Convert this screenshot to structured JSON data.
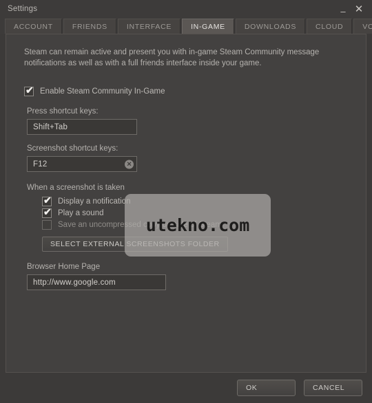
{
  "window": {
    "title": "Settings",
    "minimize_label": "–",
    "close_label": "✕"
  },
  "tabs": [
    {
      "label": "ACCOUNT",
      "active": false
    },
    {
      "label": "FRIENDS",
      "active": false
    },
    {
      "label": "INTERFACE",
      "active": false
    },
    {
      "label": "IN-GAME",
      "active": true
    },
    {
      "label": "DOWNLOADS",
      "active": false
    },
    {
      "label": "CLOUD",
      "active": false
    },
    {
      "label": "VOICE",
      "active": false
    }
  ],
  "main": {
    "description": "Steam can remain active and present you with in-game Steam Community message notifications as well as with a full friends interface inside your game.",
    "enable_community": {
      "label": "Enable Steam Community In-Game",
      "checked": true,
      "check_glyph": "✔"
    },
    "press_shortcut": {
      "label": "Press shortcut keys:",
      "value": "Shift+Tab",
      "placeholder": ""
    },
    "screenshot_shortcut": {
      "label": "Screenshot shortcut keys:",
      "value": "F12",
      "placeholder": "",
      "clear_glyph": "✕"
    },
    "screenshot_section": {
      "label": "When a screenshot is taken",
      "options": [
        {
          "label": "Display a notification",
          "checked": true
        },
        {
          "label": "Play a sound",
          "checked": true
        },
        {
          "label": "Save an uncompressed copy outside of Steam",
          "checked": false
        }
      ],
      "folder_button": "SELECT EXTERNAL SCREENSHOTS FOLDER"
    },
    "browser_home": {
      "label": "Browser Home Page",
      "value": "http://www.google.com",
      "placeholder": ""
    }
  },
  "watermark": {
    "text": "utekno.com"
  },
  "footer": {
    "ok_label": "OK",
    "cancel_label": "CANCEL"
  },
  "colors": {
    "window_bg": "#3c3a39",
    "content_bg": "#434140",
    "tab_active_bg": "#5b5754",
    "text_primary": "#bdbab6",
    "text_dim": "#908d89",
    "field_bg": "#3a3836",
    "border": "#6e6b67"
  }
}
